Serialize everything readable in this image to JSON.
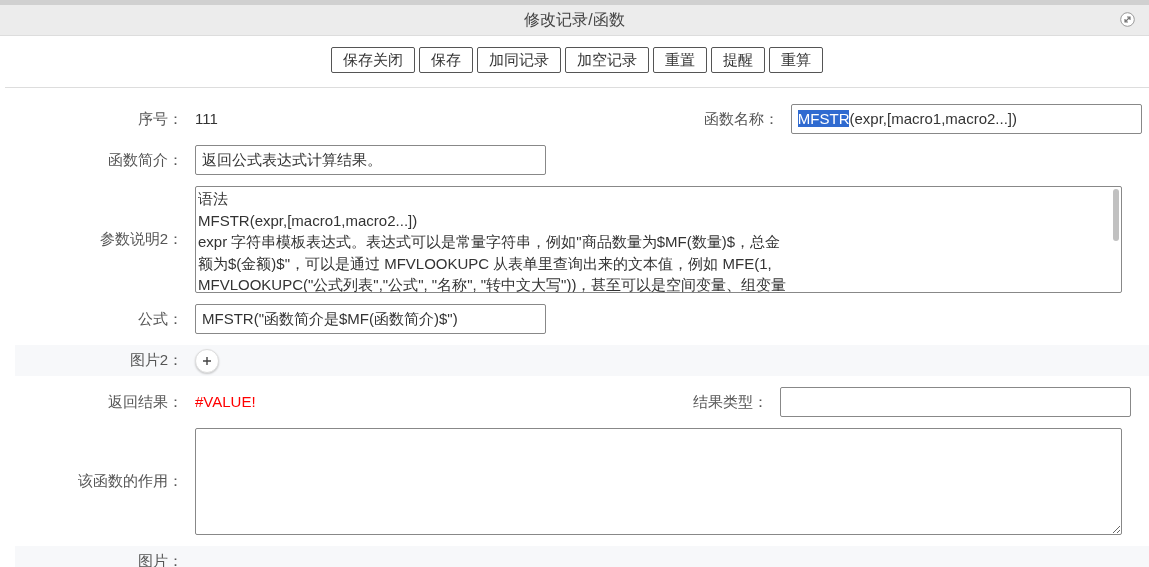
{
  "window": {
    "title": "修改记录/函数"
  },
  "toolbar": [
    "保存关闭",
    "保存",
    "加同记录",
    "加空记录",
    "重置",
    "提醒",
    "重算"
  ],
  "form": {
    "serial": {
      "label": "序号：",
      "value": "111"
    },
    "function_name": {
      "label": "函数名称：",
      "parts": [
        {
          "text": "MFSTR",
          "highlighted": true
        },
        {
          "text": "(expr,[macro1,macro2...])",
          "highlighted": false
        }
      ]
    },
    "summary": {
      "label": "函数简介：",
      "value": "返回公式表达式计算结果。"
    },
    "params": {
      "label": "参数说明2：",
      "lines": [
        "语法",
        "MFSTR(expr,[macro1,macro2...])",
        "expr 字符串模板表达式。表达式可以是常量字符串，例如\"商品数量为$MF(数量)$，总金",
        "额为$(金额)$\"，可以是通过 MFVLOOKUPC 从表单里查询出来的文本值，例如 MFE(1,",
        "MFVLOOKUPC(\"公式列表\",\"公式\", \"名称\", \"转中文大写\"))，甚至可以是空间变量、组变量"
      ]
    },
    "formula": {
      "label": "公式：",
      "value": "MFSTR(\"函数简介是$MF(函数简介)$\")"
    },
    "image2": {
      "label": "图片2："
    },
    "result": {
      "label": "返回结果：",
      "value": "#VALUE!",
      "error": true
    },
    "result_type": {
      "label": "结果类型："
    },
    "purpose": {
      "label": "该函数的作用："
    },
    "image": {
      "label": "图片："
    }
  }
}
